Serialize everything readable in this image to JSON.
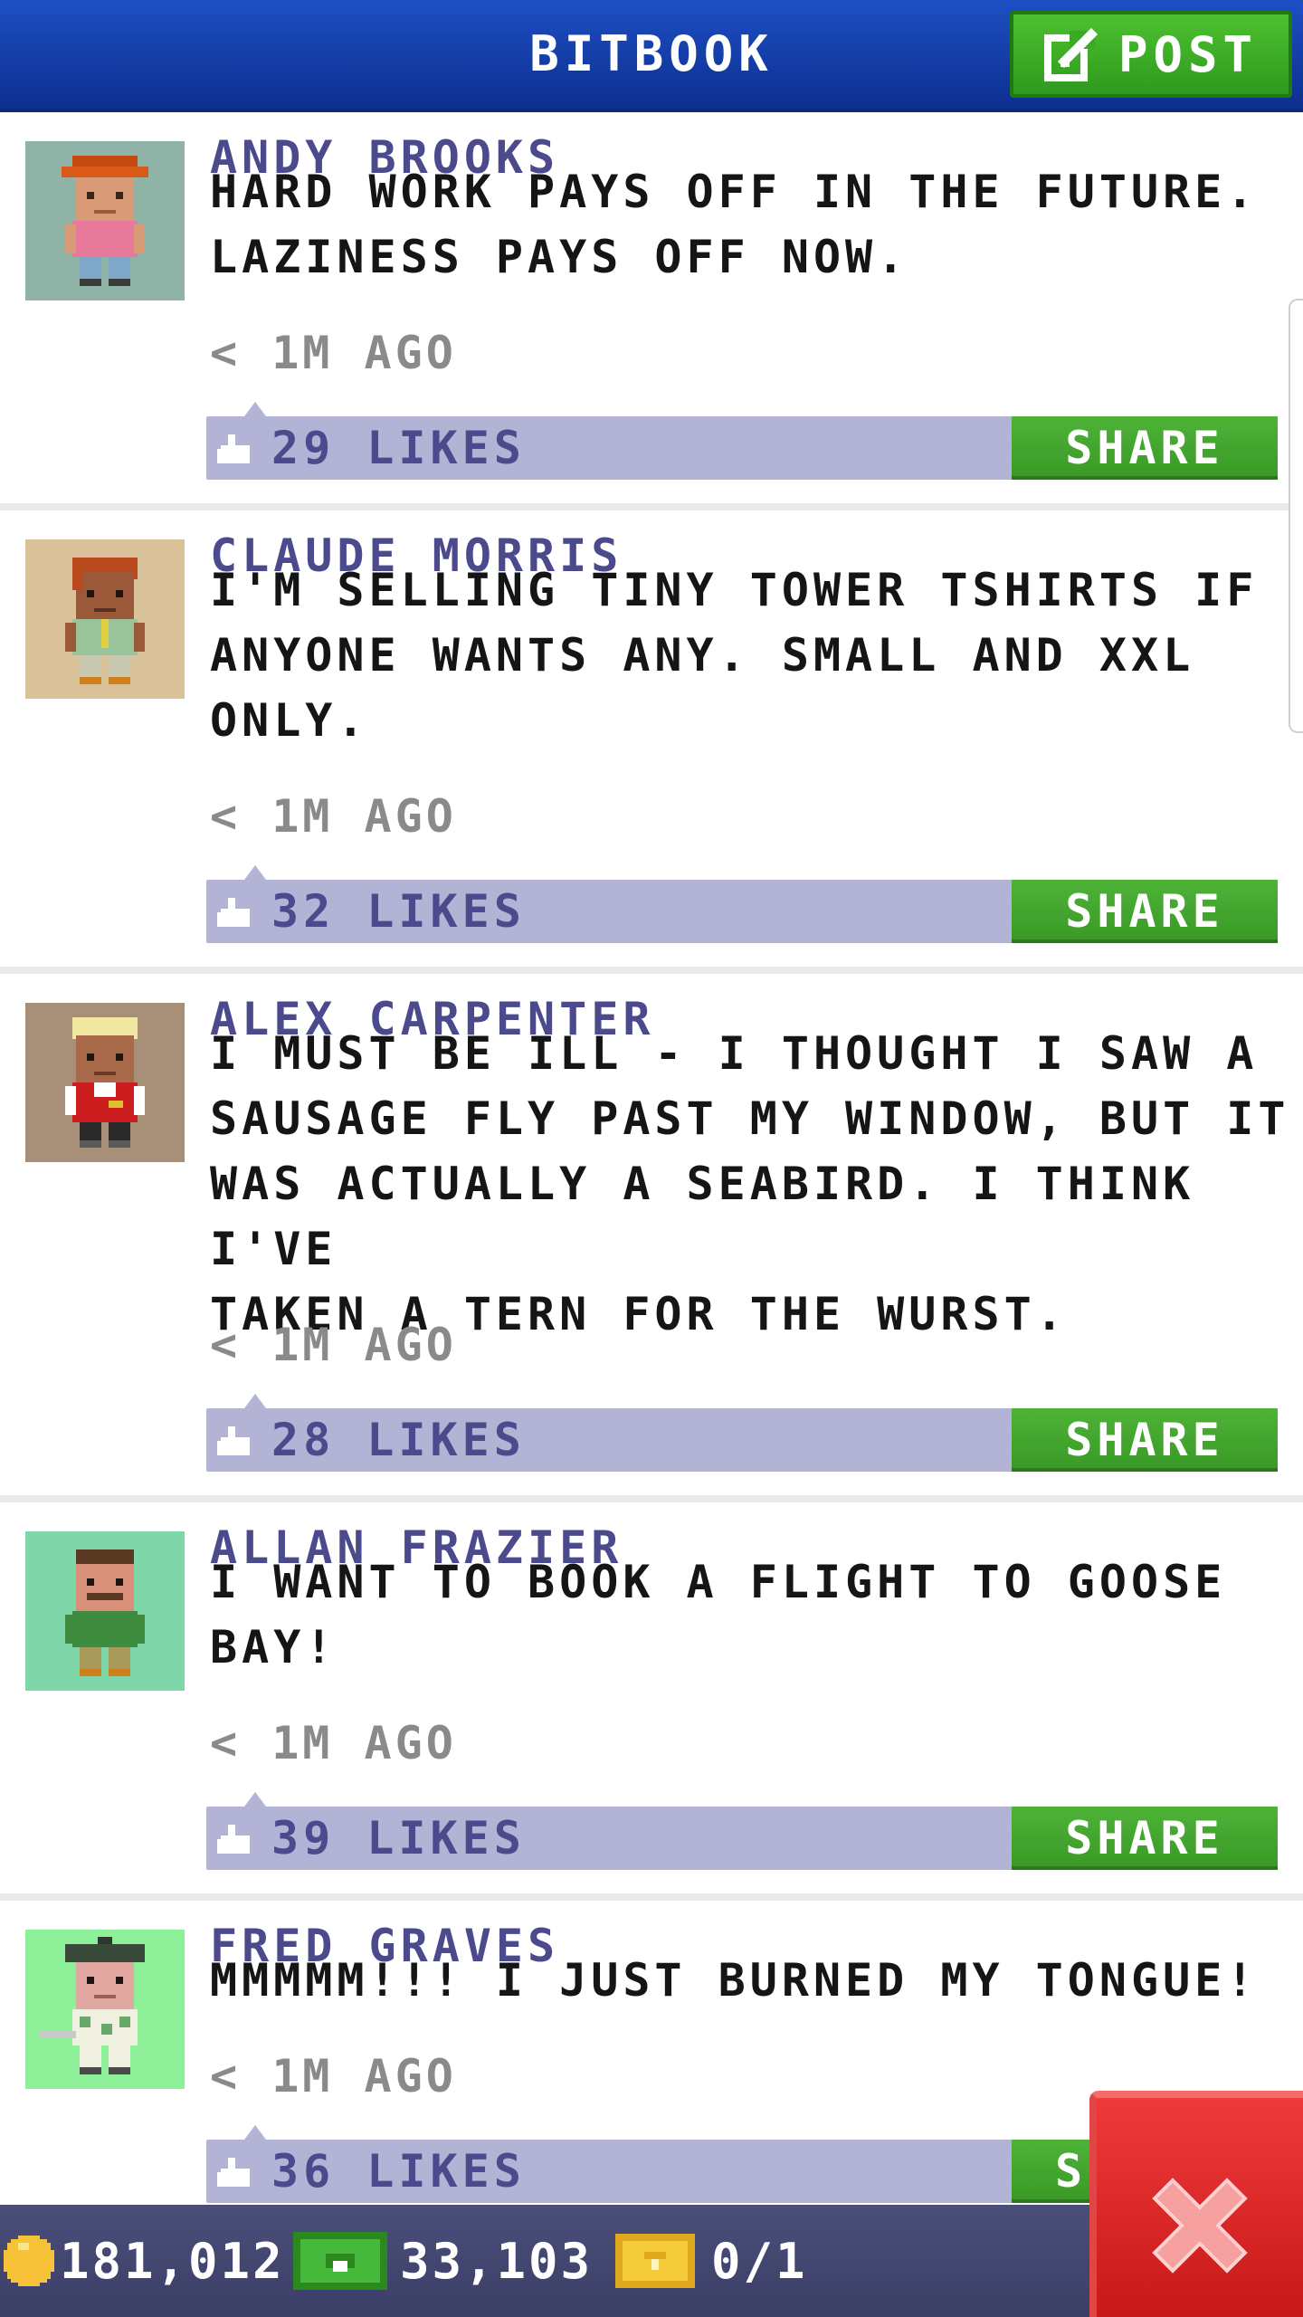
{
  "header": {
    "title": "BITBOOK",
    "post_label": "POST"
  },
  "posts": [
    {
      "author": "ANDY BROOKS",
      "lines": [
        "HARD WORK PAYS OFF IN THE FUTURE.",
        "LAZINESS PAYS OFF NOW."
      ],
      "time": "< 1M AGO",
      "likes": "29 LIKES",
      "share_label": "SHARE"
    },
    {
      "author": "CLAUDE MORRIS",
      "lines": [
        "I'M SELLING TINY TOWER TSHIRTS IF",
        "ANYONE WANTS ANY. SMALL AND XXL",
        "ONLY."
      ],
      "time": "< 1M AGO",
      "likes": "32 LIKES",
      "share_label": "SHARE"
    },
    {
      "author": "ALEX CARPENTER",
      "lines": [
        "I MUST BE ILL - I THOUGHT I SAW A",
        "SAUSAGE FLY PAST MY WINDOW, BUT IT",
        "WAS ACTUALLY A SEABIRD. I THINK I'VE",
        "TAKEN A TERN FOR THE WURST."
      ],
      "time": "< 1M AGO",
      "likes": "28 LIKES",
      "share_label": "SHARE"
    },
    {
      "author": "ALLAN FRAZIER",
      "lines": [
        "I WANT TO BOOK A FLIGHT TO GOOSE",
        "BAY!"
      ],
      "time": "< 1M AGO",
      "likes": "39 LIKES",
      "share_label": "SHARE"
    },
    {
      "author": "FRED GRAVES",
      "lines": [
        "MMMMM!!! I JUST BURNED MY TONGUE!"
      ],
      "time": "< 1M AGO",
      "likes": "36 LIKES",
      "share_label": "S"
    }
  ],
  "status_bar": {
    "coins": "181,012",
    "bux": "33,103",
    "tickets": "0/1"
  },
  "icons": {
    "post": "edit-icon",
    "like": "thumbs-up-icon",
    "coins": "coin-icon",
    "bux": "bux-icon",
    "tickets": "ticket-icon",
    "close": "close-icon"
  },
  "colors": {
    "header_blue": "#1e4fc4",
    "accent_green": "#3a9a26",
    "author_purple": "#4a4a8c",
    "likes_bar": "#b3b3d6",
    "close_red": "#d62020"
  }
}
